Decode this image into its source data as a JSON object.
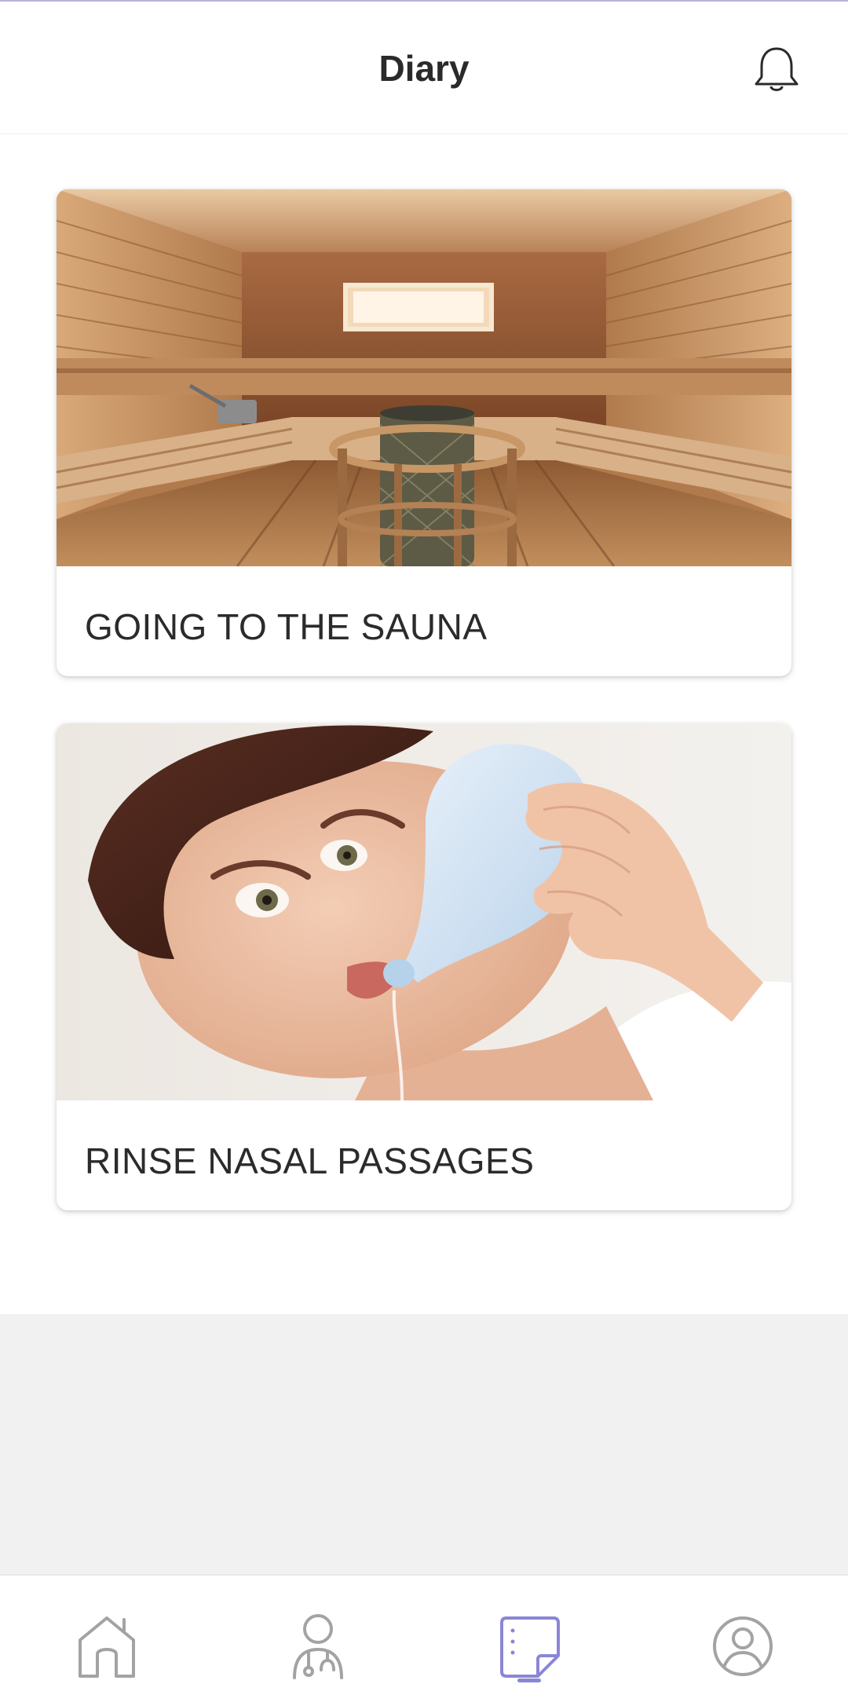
{
  "header": {
    "title": "Diary",
    "notifications_icon": "bell-icon"
  },
  "cards": [
    {
      "label": "GOING TO THE SAUNA",
      "image": "sauna-photo"
    },
    {
      "label": "RINSE NASAL PASSAGES",
      "image": "nasal-rinse-photo"
    }
  ],
  "bottom_nav": {
    "items": [
      {
        "icon": "home-icon",
        "active": false
      },
      {
        "icon": "doctor-icon",
        "active": false
      },
      {
        "icon": "diary-icon",
        "active": true
      },
      {
        "icon": "profile-icon",
        "active": false
      }
    ],
    "active_color": "#8a86d6",
    "inactive_color": "#a3a3a3"
  }
}
